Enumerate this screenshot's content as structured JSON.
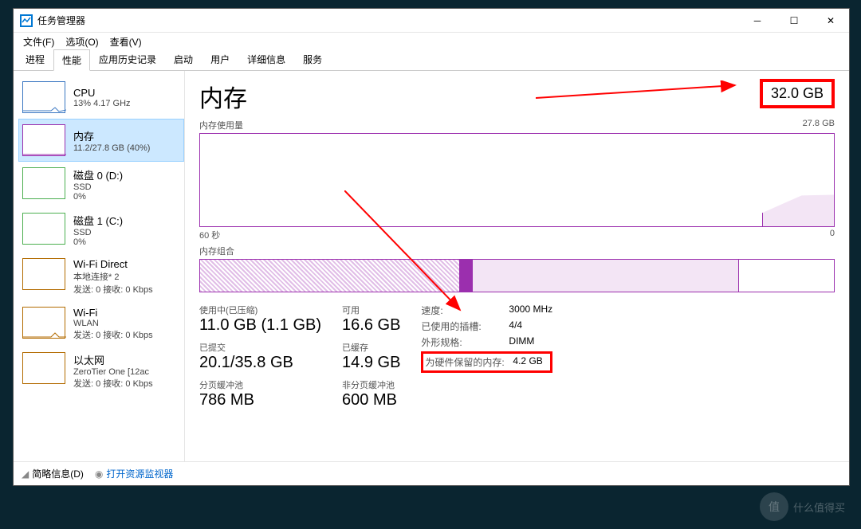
{
  "window": {
    "title": "任务管理器"
  },
  "menu": {
    "file": "文件(F)",
    "options": "选项(O)",
    "view": "查看(V)"
  },
  "tabs": {
    "processes": "进程",
    "performance": "性能",
    "app_history": "应用历史记录",
    "startup": "启动",
    "users": "用户",
    "details": "详细信息",
    "services": "服务"
  },
  "sidebar": {
    "items": [
      {
        "title": "CPU",
        "sub": "13%  4.17 GHz"
      },
      {
        "title": "内存",
        "sub": "11.2/27.8 GB (40%)"
      },
      {
        "title": "磁盘 0 (D:)",
        "sub": "SSD",
        "sub2": "0%"
      },
      {
        "title": "磁盘 1 (C:)",
        "sub": "SSD",
        "sub2": "0%"
      },
      {
        "title": "Wi-Fi Direct",
        "sub": "本地连接* 2",
        "sub2": "发送: 0 接收: 0 Kbps"
      },
      {
        "title": "Wi-Fi",
        "sub": "WLAN",
        "sub2": "发送: 0 接收: 0 Kbps"
      },
      {
        "title": "以太网",
        "sub": "ZeroTier One [12ac",
        "sub2": "发送: 0 接收: 0 Kbps"
      }
    ]
  },
  "main": {
    "heading": "内存",
    "total": "32.0 GB",
    "usage_label": "内存使用量",
    "usage_max": "27.8 GB",
    "axis_left": "60 秒",
    "axis_right": "0",
    "comp_label": "内存组合",
    "stats": {
      "in_use_label": "使用中(已压缩)",
      "in_use": "11.0 GB (1.1 GB)",
      "available_label": "可用",
      "available": "16.6 GB",
      "committed_label": "已提交",
      "committed": "20.1/35.8 GB",
      "cached_label": "已缓存",
      "cached": "14.9 GB",
      "paged_label": "分页缓冲池",
      "paged": "786 MB",
      "nonpaged_label": "非分页缓冲池",
      "nonpaged": "600 MB"
    },
    "spec": {
      "speed_k": "速度:",
      "speed_v": "3000 MHz",
      "slots_k": "已使用的插槽:",
      "slots_v": "4/4",
      "form_k": "外形规格:",
      "form_v": "DIMM",
      "reserved_k": "为硬件保留的内存:",
      "reserved_v": "4.2 GB"
    }
  },
  "footer": {
    "fewer": "简略信息(D)",
    "resmon": "打开资源监视器"
  },
  "watermark": {
    "badge": "值",
    "text": "什么值得买"
  }
}
